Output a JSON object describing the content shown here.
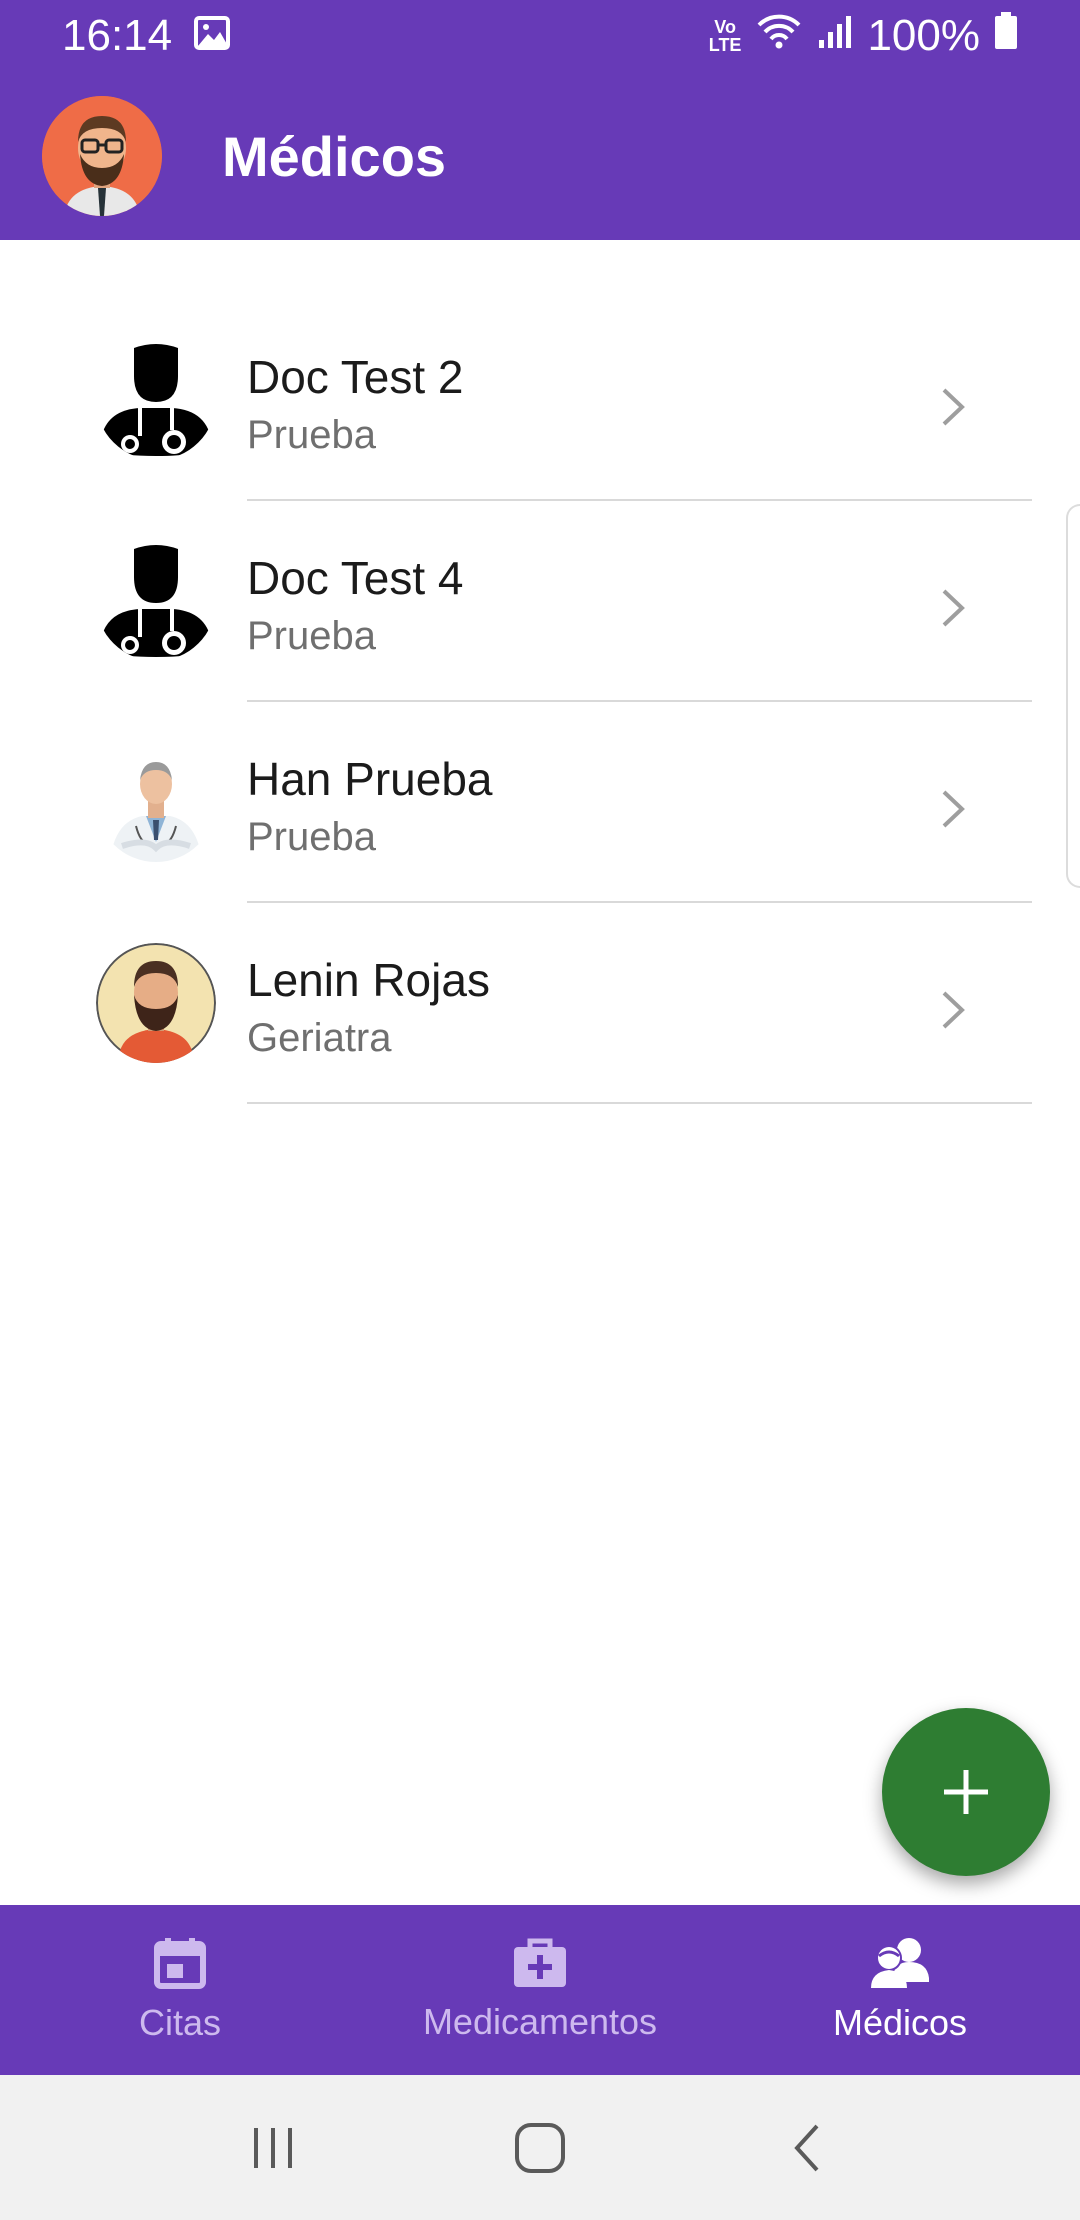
{
  "status_bar": {
    "time": "16:14",
    "battery": "100%",
    "volte_top": "Vo",
    "volte_bottom": "LTE"
  },
  "app_bar": {
    "title": "Médicos"
  },
  "doctors": [
    {
      "name": "Doc Test 2",
      "specialty": "Prueba",
      "avatar": "doctor-silhouette-icon"
    },
    {
      "name": "Doc Test 4",
      "specialty": "Prueba",
      "avatar": "doctor-silhouette-icon"
    },
    {
      "name": "Han Prueba",
      "specialty": "Prueba",
      "avatar": "doctor-photo"
    },
    {
      "name": "Lenin Rojas",
      "specialty": "Geriatra",
      "avatar": "bearded-man-avatar"
    }
  ],
  "fab": {
    "icon": "plus-icon"
  },
  "bottom_nav": {
    "items": [
      {
        "label": "Citas",
        "icon": "calendar-icon",
        "active": false
      },
      {
        "label": "Medicamentos",
        "icon": "medkit-icon",
        "active": false
      },
      {
        "label": "Médicos",
        "icon": "doctors-icon",
        "active": true
      }
    ]
  },
  "colors": {
    "primary": "#673ab7",
    "fab": "#2e7d32",
    "inactive_nav": "#cdb9ee"
  }
}
